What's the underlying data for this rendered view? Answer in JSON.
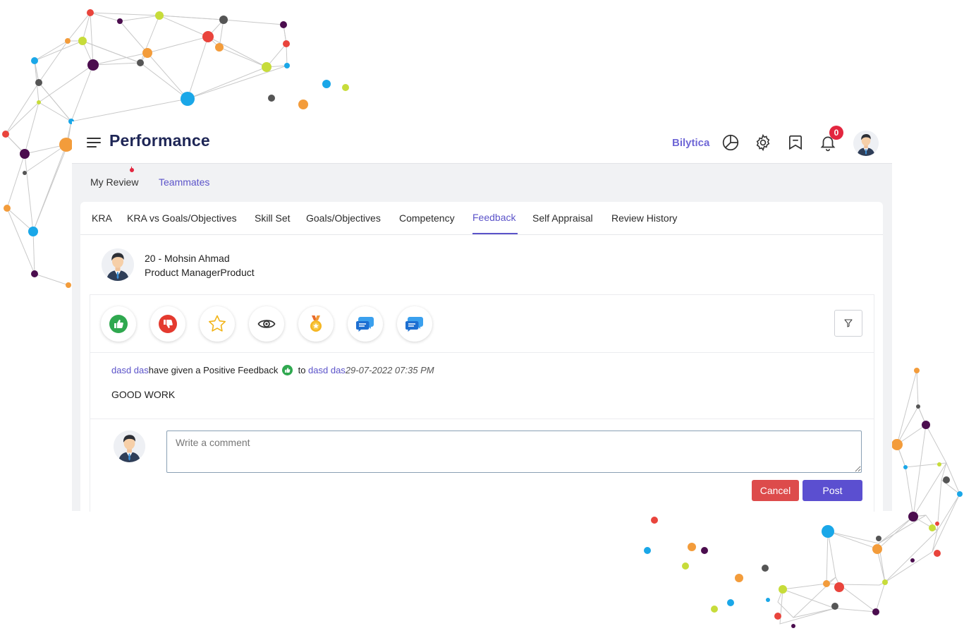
{
  "header": {
    "title": "Performance",
    "brand": "Bilytica",
    "notifications_count": "0",
    "icons": [
      "menu-icon",
      "pie-chart-icon",
      "gear-icon",
      "bookmark-icon",
      "bell-icon",
      "avatar"
    ]
  },
  "top_tabs": [
    {
      "label": "My Review",
      "active": true
    },
    {
      "label": "Teammates",
      "active": false
    }
  ],
  "sub_tabs": [
    {
      "label": "KRA"
    },
    {
      "label": "KRA vs Goals/Objectives"
    },
    {
      "label": "Skill Set"
    },
    {
      "label": "Goals/Objectives"
    },
    {
      "label": "Competency"
    },
    {
      "label": "Feedback",
      "active": true
    },
    {
      "label": "Self Appraisal"
    },
    {
      "label": "Review History"
    }
  ],
  "employee": {
    "name": "20 - Mohsin Ahmad",
    "role": "Product ManagerProduct"
  },
  "feedback_types": [
    "thumbs-up-icon",
    "thumbs-down-icon",
    "star-icon",
    "eye-icon",
    "medal-icon",
    "chat-icon",
    "chat-icon"
  ],
  "feed": {
    "from_user": "dasd das",
    "action": "have given a Positive Feedback",
    "to_word": "to",
    "to_user": "dasd das",
    "date": "29-07-2022 07:35 PM",
    "message": "GOOD WORK"
  },
  "comment": {
    "placeholder": "Write a comment",
    "cancel_label": "Cancel",
    "post_label": "Post"
  },
  "colors": {
    "accent": "#5b53c9",
    "title": "#1e2656",
    "cancel": "#dd4b4b",
    "post": "#5b4fd0",
    "badge": "#e3263f"
  }
}
